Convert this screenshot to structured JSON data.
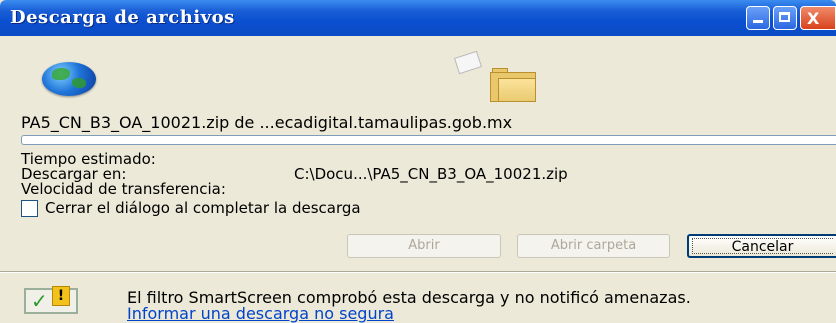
{
  "window": {
    "title": "Descarga de archivos",
    "controls": {
      "minimize": "minimize-icon",
      "maximize": "maximize-icon",
      "close": "close-icon",
      "close_glyph": "X"
    }
  },
  "download": {
    "file_source": "PA5_CN_B3_OA_10021.zip de ...ecadigital.tamaulipas.gob.mx",
    "progress_fraction": 0,
    "estimated_time_label": "Tiempo estimado:",
    "destination_label": "Descargar en:",
    "destination_value": "C:\\Docu...\\PA5_CN_B3_OA_10021.zip",
    "speed_label": "Velocidad de transferencia:"
  },
  "options": {
    "close_on_complete_label": "Cerrar el diálogo al completar la descarga",
    "close_on_complete_checked": false
  },
  "buttons": {
    "open": "Abrir",
    "open_folder": "Abrir carpeta",
    "cancel": "Cancelar"
  },
  "smartscreen": {
    "message": "El filtro SmartScreen comprobó esta descarga y no notificó amenazas.",
    "report_link": "Informar una descarga no segura",
    "warn_glyph": "!"
  },
  "icons": [
    "globe-icon",
    "document-icon",
    "folder-icon",
    "smartscreen-shield-icon"
  ],
  "colors": {
    "titlebar": "#0b4cc4",
    "window_bg": "#ece9d8",
    "link": "#0044cc"
  }
}
